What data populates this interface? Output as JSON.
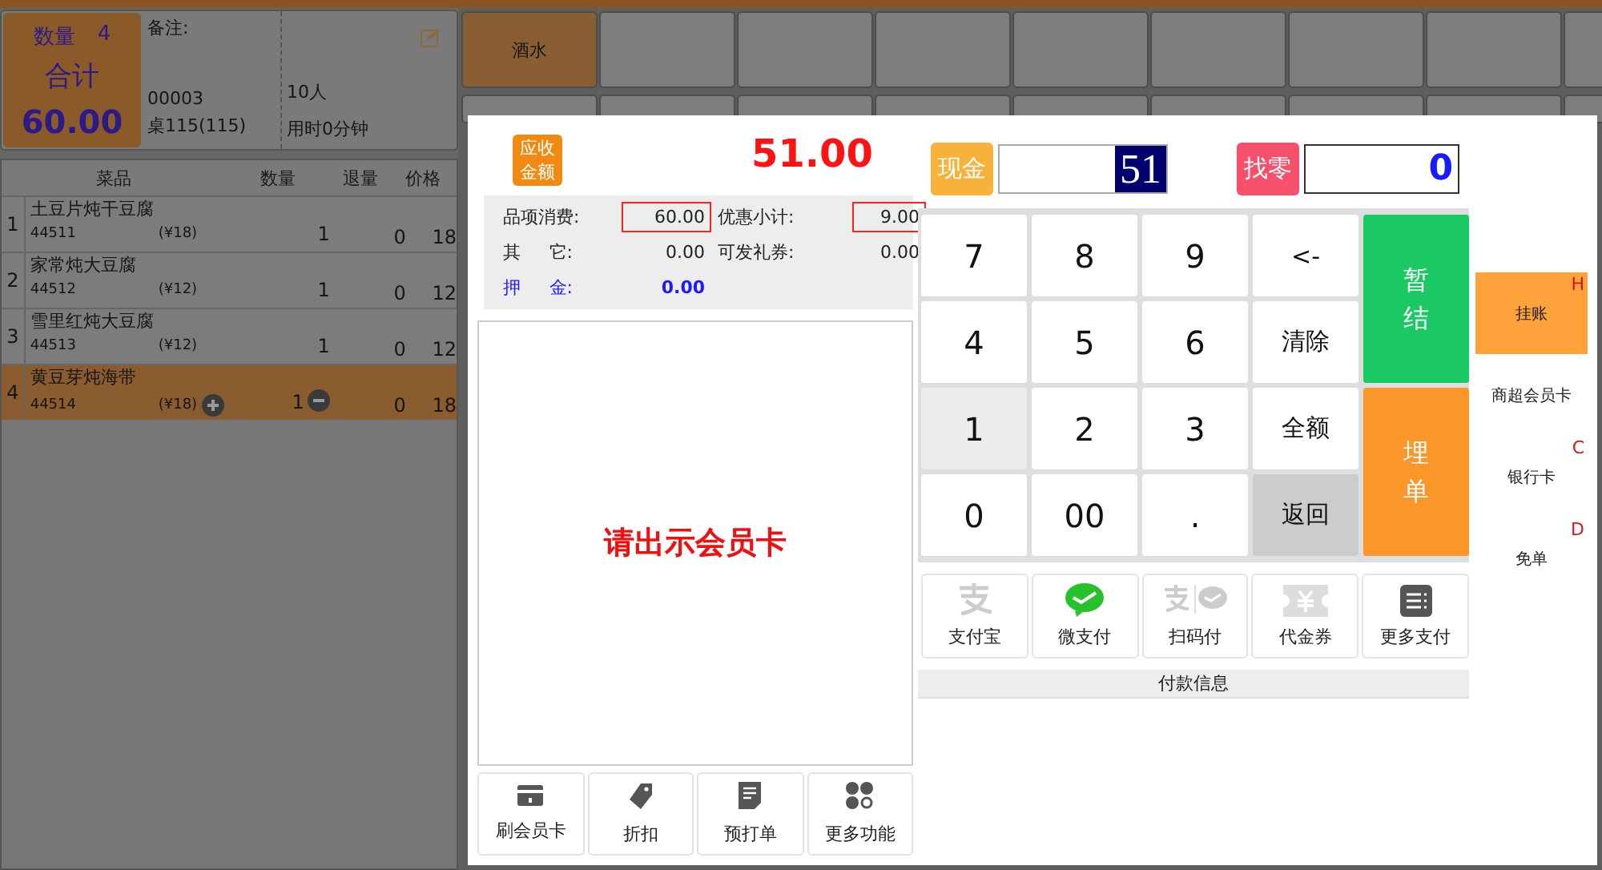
{
  "order_summary": {
    "count_label": "数量",
    "count": "4",
    "total_label": "合计",
    "total": "60.00",
    "remark_label": "备注:",
    "order_no": "00003",
    "table": "桌115(115)",
    "guests": "10人",
    "duration": "用时0分钟"
  },
  "order_table": {
    "columns": [
      "菜品",
      "数量",
      "退量",
      "价格"
    ],
    "rows": [
      {
        "index": "1",
        "name": "土豆片炖干豆腐",
        "code": "44511",
        "unit_price": "(¥18)",
        "qty": "1",
        "returned": "0",
        "price": "18",
        "selected": false
      },
      {
        "index": "2",
        "name": "家常炖大豆腐",
        "code": "44512",
        "unit_price": "(¥12)",
        "qty": "1",
        "returned": "0",
        "price": "12",
        "selected": false
      },
      {
        "index": "3",
        "name": "雪里红炖大豆腐",
        "code": "44513",
        "unit_price": "(¥12)",
        "qty": "1",
        "returned": "0",
        "price": "12",
        "selected": false
      },
      {
        "index": "4",
        "name": "黄豆芽炖海带",
        "code": "44514",
        "unit_price": "(¥18)",
        "qty": "1",
        "returned": "0",
        "price": "18",
        "selected": true
      }
    ]
  },
  "categories": [
    {
      "label": "酒水",
      "selected": true
    }
  ],
  "payment_dialog": {
    "due_label": "应收金额",
    "due_amount": "51.00",
    "summary": [
      {
        "label": "品项消费:",
        "value": "60.00",
        "highlighted": true,
        "kind": "normal"
      },
      {
        "label": "优惠小计:",
        "value": "9.00",
        "highlighted": true,
        "kind": "normal"
      },
      {
        "label": "其 它:",
        "value": "0.00",
        "highlighted": false,
        "kind": "normal"
      },
      {
        "label": "可发礼券:",
        "value": "0.00",
        "highlighted": false,
        "kind": "normal"
      },
      {
        "label": "押 金:",
        "value": "0.00",
        "highlighted": false,
        "kind": "deposit"
      }
    ],
    "member_prompt": "请出示会员卡",
    "actions": [
      {
        "label": "刷会员卡",
        "kind": "card"
      },
      {
        "label": "折扣",
        "kind": "tag"
      },
      {
        "label": "预打单",
        "kind": "doc"
      },
      {
        "label": "更多功能",
        "kind": "more"
      }
    ],
    "cash": {
      "label": "现金",
      "value": "51"
    },
    "change": {
      "label": "找零",
      "value": "0"
    },
    "keys": [
      {
        "label": "7",
        "kind": "key",
        "highlighted": false
      },
      {
        "label": "8",
        "kind": "key",
        "highlighted": false
      },
      {
        "label": "9",
        "kind": "key",
        "highlighted": false
      },
      {
        "label": "<-",
        "kind": "key",
        "highlighted": false
      },
      {
        "label": "暂结",
        "kind": "settle"
      },
      {
        "label": "4",
        "kind": "key",
        "highlighted": false
      },
      {
        "label": "5",
        "kind": "key",
        "highlighted": false
      },
      {
        "label": "6",
        "kind": "key",
        "highlighted": false
      },
      {
        "label": "清除",
        "kind": "key",
        "highlighted": false
      },
      {
        "label": "1",
        "kind": "key",
        "highlighted": true
      },
      {
        "label": "2",
        "kind": "key",
        "highlighted": false
      },
      {
        "label": "3",
        "kind": "key",
        "highlighted": false
      },
      {
        "label": "全额",
        "kind": "key",
        "highlighted": false
      },
      {
        "label": "埋单",
        "kind": "pay"
      },
      {
        "label": "0",
        "kind": "key",
        "highlighted": false
      },
      {
        "label": "00",
        "kind": "key",
        "highlighted": false
      },
      {
        "label": ".",
        "kind": "key",
        "highlighted": false
      },
      {
        "label": "返回",
        "kind": "back"
      }
    ],
    "payments": [
      {
        "label": "支付宝",
        "kind": "alipay"
      },
      {
        "label": "微支付",
        "kind": "wechat"
      },
      {
        "label": "扫码付",
        "kind": "scan"
      },
      {
        "label": "代金券",
        "kind": "voucher"
      },
      {
        "label": "更多支付",
        "kind": "more"
      }
    ],
    "payment_info_label": "付款信息",
    "side_methods": [
      {
        "label": "挂账",
        "shortcut": "H",
        "selected": true
      },
      {
        "label": "商超会员卡",
        "selected": false
      },
      {
        "label": "银行卡",
        "shortcut": "C",
        "selected": false
      },
      {
        "label": "免单",
        "shortcut": "D",
        "selected": false
      }
    ]
  }
}
